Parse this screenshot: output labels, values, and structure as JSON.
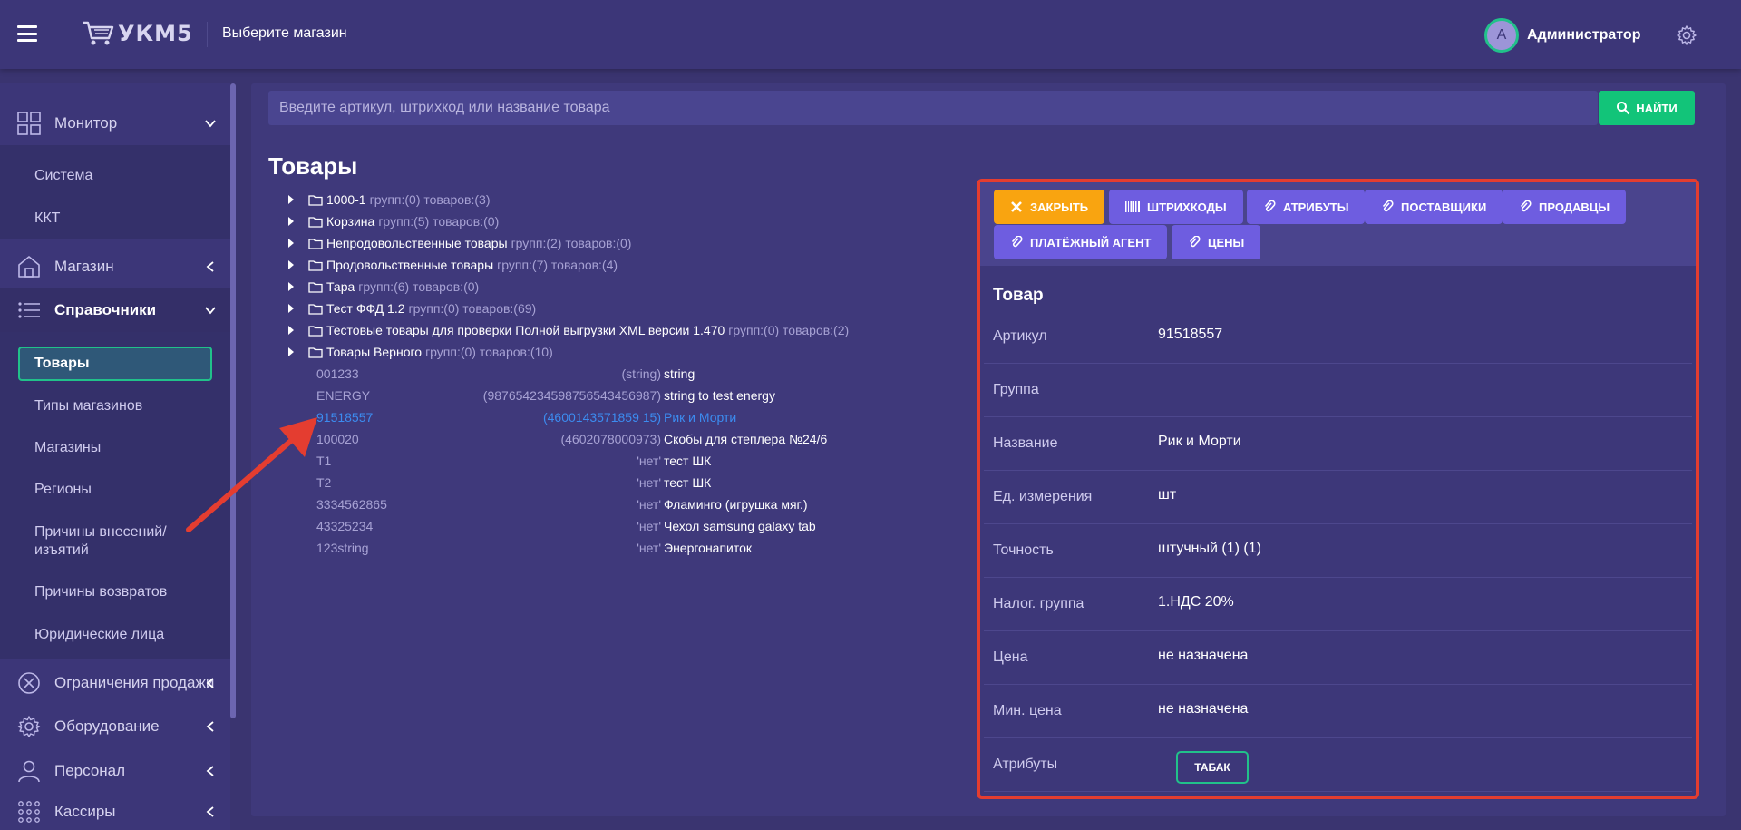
{
  "app": {
    "logo_text": "УКМ5",
    "store_select": "Выберите магазин",
    "user_initial": "А",
    "user_name": "Администратор"
  },
  "sidebar": {
    "sections": [
      {
        "label": "Монитор",
        "icon": "grid-icon"
      },
      {
        "label": "Магазин",
        "icon": "store-icon"
      },
      {
        "label": "Справочники",
        "icon": "list-icon"
      },
      {
        "label": "Ограничения продажи",
        "icon": "block-icon"
      },
      {
        "label": "Оборудование",
        "icon": "gear-icon"
      },
      {
        "label": "Персонал",
        "icon": "person-icon"
      },
      {
        "label": "Кассиры",
        "icon": "dots-grid-icon"
      }
    ],
    "monitor_items": [
      "Система",
      "ККТ"
    ],
    "dict_items": [
      "Товары",
      "Типы магазинов",
      "Магазины",
      "Регионы",
      "Причины внесений/",
      "изъятий",
      "Причины возвратов",
      "Юридические лица"
    ]
  },
  "search": {
    "placeholder": "Введите артикул, штрихкод или название товара",
    "button": "НАЙТИ"
  },
  "page_title": "Товары",
  "tree": [
    {
      "name": "1000-1",
      "meta": "групп:(0) товаров:(3)"
    },
    {
      "name": "Корзина",
      "meta": "групп:(5) товаров:(0)"
    },
    {
      "name": "Непродовольственные товары",
      "meta": "групп:(2) товаров:(0)"
    },
    {
      "name": "Продовольственные товары",
      "meta": "групп:(7) товаров:(4)"
    },
    {
      "name": "Тара",
      "meta": "групп:(6) товаров:(0)"
    },
    {
      "name": "Тест ФФД 1.2",
      "meta": "групп:(0) товаров:(69)"
    },
    {
      "name": "Тестовые товары для проверки Полной выгрузки XML версии 1.470",
      "meta": "групп:(0) товаров:(2)"
    },
    {
      "name": "Товары Верного",
      "meta": "групп:(0) товаров:(10)"
    }
  ],
  "goods": [
    {
      "code": "001233",
      "barcode": "(string)",
      "name": "string"
    },
    {
      "code": "ENERGY",
      "barcode": "(987654234598756543456987)",
      "name": "string to test energy"
    },
    {
      "code": "91518557",
      "barcode": "(4600143571859 15)",
      "name": "Рик и Морти"
    },
    {
      "code": "100020",
      "barcode": "(4602078000973)",
      "name": "Скобы для степлера №24/6"
    },
    {
      "code": "T1",
      "barcode": "'нет'",
      "name": "тест ШК"
    },
    {
      "code": "T2",
      "barcode": "'нет'",
      "name": "тест ШК"
    },
    {
      "code": "3334562865",
      "barcode": "'нет'",
      "name": "Фламинго (игрушка мяг.)"
    },
    {
      "code": "43325234",
      "barcode": "'нет'",
      "name": "Чехол samsung galaxy tab"
    },
    {
      "code": "123string",
      "barcode": "'нет'",
      "name": "Энергонапиток"
    }
  ],
  "panel": {
    "tabs": {
      "close": "ЗАКРЫТЬ",
      "barcodes": "ШТРИХКОДЫ",
      "attributes": "АТРИБУТЫ",
      "suppliers": "ПОСТАВЩИКИ",
      "sellers": "ПРОДАВЦЫ",
      "pay_agent": "ПЛАТЁЖНЫЙ АГЕНТ",
      "prices": "ЦЕНЫ"
    },
    "title": "Товар",
    "rows": [
      {
        "label": "Артикул",
        "value": "91518557"
      },
      {
        "label": "Группа",
        "value": ""
      },
      {
        "label": "Название",
        "value": "Рик и Морти"
      },
      {
        "label": "Ед. измерения",
        "value": "шт"
      },
      {
        "label": "Точность",
        "value": "штучный (1) (1)"
      },
      {
        "label": "Налог. группа",
        "value": "1.НДС 20%"
      },
      {
        "label": "Цена",
        "value": "не назначена"
      },
      {
        "label": "Мин. цена",
        "value": "не назначена"
      },
      {
        "label": "Атрибуты",
        "value": ""
      }
    ],
    "attribute_tag": "ТАБАК"
  },
  "colors": {
    "accent_green": "#21c18a",
    "close_orange": "#f9a410",
    "tab_purple": "#6e5de0",
    "highlight_red": "#e43d30",
    "link_blue": "#3c8cf0"
  }
}
